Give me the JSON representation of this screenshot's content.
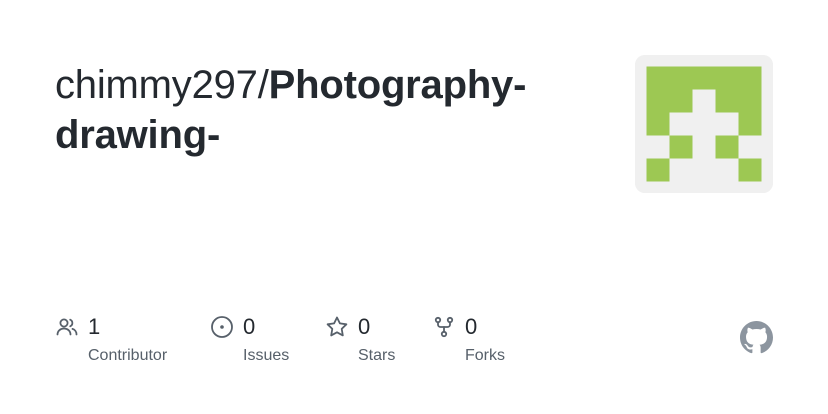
{
  "repo": {
    "owner": "chimmy297",
    "separator": "/",
    "name": "Photography-drawing-"
  },
  "stats": {
    "contributors": {
      "count": "1",
      "label": "Contributor"
    },
    "issues": {
      "count": "0",
      "label": "Issues"
    },
    "stars": {
      "count": "0",
      "label": "Stars"
    },
    "forks": {
      "count": "0",
      "label": "Forks"
    }
  },
  "icons": {
    "contributors": "people-icon",
    "issues": "issue-opened-icon",
    "stars": "star-icon",
    "forks": "repo-forked-icon",
    "brand": "github-mark-icon",
    "avatar": "identicon"
  },
  "colors": {
    "avatar_fg": "#9dc853",
    "avatar_bg": "#f0f0f0",
    "text": "#24292f",
    "muted": "#57606a"
  }
}
